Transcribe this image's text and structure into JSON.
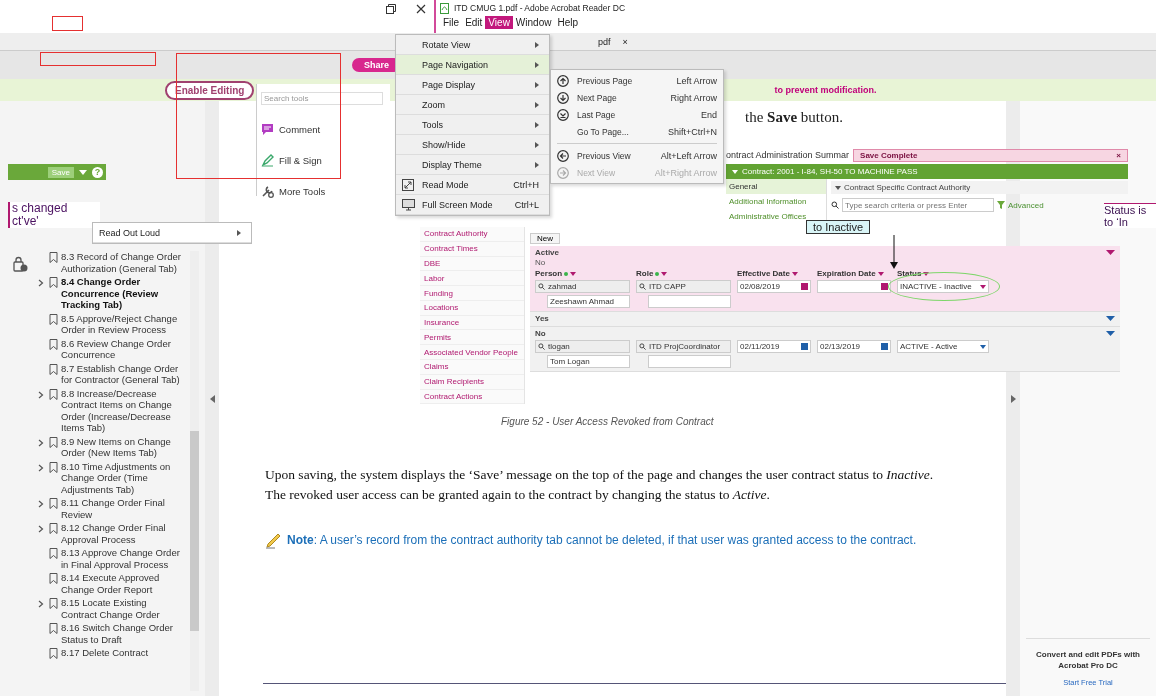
{
  "window": {
    "title": "ITD CMUG 1.pdf - Adobe Acrobat Reader DC"
  },
  "menu_bar": [
    {
      "label": "File",
      "selected": false
    },
    {
      "label": "Edit",
      "selected": false
    },
    {
      "label": "View",
      "selected": true
    },
    {
      "label": "Window",
      "selected": false
    },
    {
      "label": "Help",
      "selected": false
    }
  ],
  "document_tab": {
    "label": "pdf",
    "close": "×"
  },
  "toolbar": {
    "share_button": "Share"
  },
  "protected_view": {
    "button": "Enable Editing",
    "message": "to prevent modification."
  },
  "view_menu": [
    {
      "label": "Rotate View",
      "kind": "submenu",
      "selected": false
    },
    {
      "label": "Page Navigation",
      "kind": "submenu",
      "selected": true
    },
    {
      "label": "Page Display",
      "kind": "submenu",
      "selected": false
    },
    {
      "label": "Zoom",
      "kind": "submenu",
      "selected": false
    },
    {
      "label": "Tools",
      "kind": "submenu",
      "selected": false
    },
    {
      "label": "Show/Hide",
      "kind": "submenu",
      "selected": false
    },
    {
      "label": "Display Theme",
      "kind": "submenu",
      "selected": false
    },
    {
      "label": "Read Mode",
      "kind": "command",
      "shortcut": "Ctrl+H",
      "selected": false
    },
    {
      "label": "Full Screen Mode",
      "kind": "command",
      "shortcut": "Ctrl+L",
      "selected": false
    }
  ],
  "read_out_loud_menu": [
    {
      "label": "Read Out Loud",
      "kind": "submenu",
      "selected": false
    }
  ],
  "page_navigation_menu": [
    [
      {
        "label": "Previous Page",
        "shortcut": "Left Arrow",
        "disabled": false
      },
      {
        "label": "Next Page",
        "shortcut": "Right Arrow",
        "disabled": false
      },
      {
        "label": "Last Page",
        "shortcut": "End",
        "disabled": false
      },
      {
        "label": "Go To Page...",
        "shortcut": "Shift+Ctrl+N",
        "disabled": false
      }
    ],
    [
      {
        "label": "Previous View",
        "shortcut": "Alt+Left Arrow",
        "disabled": false
      },
      {
        "label": "Next View",
        "shortcut": "Alt+Right Arrow",
        "disabled": true
      }
    ]
  ],
  "tools_pane": {
    "search_placeholder": "Search tools",
    "items": [
      "Comment",
      "Fill & Sign",
      "More Tools"
    ]
  },
  "page_fragment": {
    "save_button": "Save",
    "help": "?",
    "callout_lines": [
      "s changed",
      "ct've'"
    ]
  },
  "bookmarks": [
    {
      "label": "8.3 Record of Change Order Authorization (General Tab)",
      "has_children": false,
      "selected": false
    },
    {
      "label": "8.4 Change Order Concurrence (Review Tracking Tab)",
      "has_children": true,
      "selected": true
    },
    {
      "label": "8.5 Approve/Reject Change Order in Review Process",
      "has_children": false,
      "selected": false
    },
    {
      "label": "8.6 Review Change Order Concurrence",
      "has_children": false,
      "selected": false
    },
    {
      "label": "8.7 Establish Change Order for Contractor (General Tab)",
      "has_children": false,
      "selected": false
    },
    {
      "label": "8.8 Increase/Decrease Contract Items on Change Order (Increase/Decrease Items Tab)",
      "has_children": true,
      "selected": false
    },
    {
      "label": "8.9 New Items on Change Order (New Items Tab)",
      "has_children": true,
      "selected": false
    },
    {
      "label": "8.10 Time Adjustments on Change Order (Time Adjustments Tab)",
      "has_children": true,
      "selected": false
    },
    {
      "label": "8.11 Change Order Final Review",
      "has_children": true,
      "selected": false
    },
    {
      "label": "8.12 Change Order Final Approval Process",
      "has_children": true,
      "selected": false
    },
    {
      "label": "8.13 Approve Change Order in Final Approval Process",
      "has_children": false,
      "selected": false
    },
    {
      "label": "8.14 Execute Approved Change Order Report",
      "has_children": false,
      "selected": false
    },
    {
      "label": "8.15  Locate Existing Contract Change Order",
      "has_children": true,
      "selected": false
    },
    {
      "label": "8.16 Switch Change Order Status to Draft",
      "has_children": false,
      "selected": false
    },
    {
      "label": "8.17 Delete Contract",
      "has_children": false,
      "selected": false
    }
  ],
  "document": {
    "heading_fragment": "the **Save** button.",
    "figure": {
      "title": "ontract Administration Summar",
      "alert": "Save Complete",
      "alert_close": "×",
      "contract_bar": "Contract: 2001 - I-84, SH-50 TO MACHINE PASS",
      "sub_nav": [
        {
          "label": "General",
          "selected": true
        },
        {
          "label": "Additional Information",
          "selected": false
        },
        {
          "label": "Administrative Offices",
          "selected": false
        }
      ],
      "section": "Contract Specific Contract Authority",
      "search_placeholder": "Type search criteria or press Enter",
      "advanced": "Advanced",
      "nav": [
        "Contract Authority",
        "Contract Times",
        "DBE",
        "Labor",
        "Funding",
        "Locations",
        "Insurance",
        "Permits",
        "Associated Vendor People",
        "Claims",
        "Claim Recipients",
        "Contract Actions"
      ],
      "new_button": "New",
      "callout": "to Inactive",
      "columns": [
        {
          "label": "Person",
          "required": true
        },
        {
          "label": "Role",
          "required": true
        },
        {
          "label": "Effective Date",
          "required": false
        },
        {
          "label": "Expiration Date",
          "required": false
        },
        {
          "label": "Status",
          "required": false
        }
      ],
      "records": [
        {
          "label": "Active",
          "value": "No",
          "selected": true,
          "expanded": true,
          "circled": true,
          "person": "zahmad",
          "person_name": "Zeeshawn Ahmad",
          "role": "ITD CAPP",
          "effective_date": "02/08/2019",
          "status": "INACTIVE - Inactive"
        },
        {
          "label": "Yes",
          "selected": false,
          "expanded": false
        },
        {
          "label": "No",
          "selected": false,
          "expanded": true,
          "circled": false,
          "person": "tlogan",
          "person_name": "Tom Logan",
          "role": "ITD ProjCoordinator",
          "effective_date": "02/11/2019",
          "expiration_date": "02/13/2019",
          "status": "ACTIVE - Active"
        }
      ]
    },
    "caption": "Figure 52 - User Access Revoked from Contract",
    "paragraph": "Upon saving, the system displays the ‘Save’ message on the top of the page and changes the user contract status to *Inactive*. The revoked user access can be granted again to the contract by changing the status to *Active*.",
    "note": "**Note**: A user’s record from the contract authority tab cannot be deleted, if that user was granted access to the contract."
  },
  "right_pane": {
    "promo": "Convert and edit PDFs with Acrobat Pro DC",
    "trial_link": "Start Free Trial"
  },
  "right_callout": [
    "Status is",
    "to ‘In"
  ]
}
